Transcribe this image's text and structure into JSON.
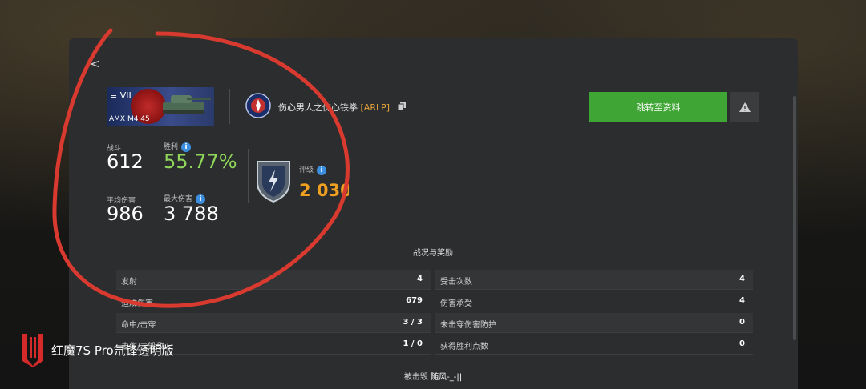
{
  "back": {
    "icon": "chevron-left-icon",
    "label": "<"
  },
  "tank": {
    "tier": "VII",
    "name": "AMX M4 45"
  },
  "player": {
    "name": "伤心男人之伤心铁拳 ",
    "clan": "[ARLP]"
  },
  "buttons": {
    "profile": "跳转至资料",
    "report_icon": "warning-icon"
  },
  "stats": {
    "battles_label": "战斗",
    "battles": "612",
    "win_label": "胜利",
    "win": "55.77%",
    "avg_dmg_label": "平均伤害",
    "avg_dmg": "986",
    "max_dmg_label": "最大伤害",
    "max_dmg": "3 788",
    "rating_label": "评级",
    "rating": "2 030"
  },
  "section_title": "战况与奖励",
  "left_rows": [
    {
      "label": "发射",
      "value": "4"
    },
    {
      "label": "造成伤害",
      "value": "679"
    },
    {
      "label": "命中/击穿",
      "value": "3 / 3"
    },
    {
      "label": "击伤/击毁敌人",
      "value": "1 / 0"
    }
  ],
  "right_rows": [
    {
      "label": "受击次数",
      "value": "4"
    },
    {
      "label": "伤害承受",
      "value": "4"
    },
    {
      "label": "未击穿伤害防护",
      "value": "0"
    },
    {
      "label": "获得胜利点数",
      "value": "0"
    }
  ],
  "killed_by": {
    "label": "被击毁",
    "name": "随风-_-||"
  },
  "watermark": "红魔7S Pro氘锋透明版",
  "colors": {
    "accent_green": "#3fa534",
    "win_green": "#8fd65a",
    "rating_orange": "#f0a020",
    "annotation_red": "#d83a30"
  }
}
